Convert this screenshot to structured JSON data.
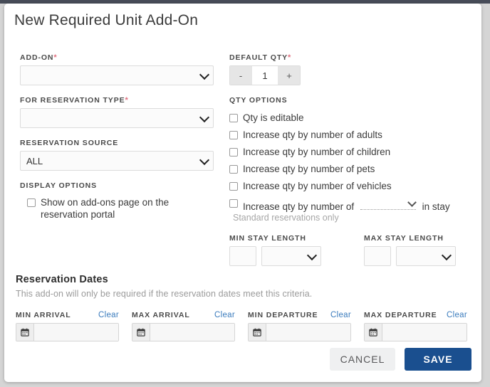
{
  "modal": {
    "title": "New Required Unit Add-On"
  },
  "left": {
    "addon": {
      "label": "ADD-ON",
      "required": "*",
      "value": ""
    },
    "reservation_type": {
      "label": "FOR RESERVATION TYPE",
      "required": "*",
      "value": ""
    },
    "reservation_source": {
      "label": "RESERVATION SOURCE",
      "value": "ALL"
    },
    "display_options": {
      "label": "DISPLAY OPTIONS",
      "checkbox": {
        "label": "Show on add-ons page on the reservation portal",
        "checked": false
      }
    }
  },
  "right": {
    "default_qty": {
      "label": "DEFAULT QTY",
      "required": "*",
      "value": "1",
      "decrement": "-",
      "increment": "+"
    },
    "qty_options": {
      "label": "QTY OPTIONS",
      "items": [
        {
          "label": "Qty is editable",
          "checked": false
        },
        {
          "label": "Increase qty by number of adults",
          "checked": false
        },
        {
          "label": "Increase qty by number of children",
          "checked": false
        },
        {
          "label": "Increase qty by number of pets",
          "checked": false
        },
        {
          "label": "Increase qty by number of vehicles",
          "checked": false
        }
      ],
      "custom_row": {
        "prefix": "Increase qty by number of",
        "select_value": "",
        "suffix": "in stay",
        "checked": false,
        "hint": "Standard reservations only"
      }
    },
    "min_stay": {
      "label": "MIN STAY LENGTH",
      "number": "",
      "unit": ""
    },
    "max_stay": {
      "label": "MAX STAY LENGTH",
      "number": "",
      "unit": ""
    }
  },
  "reservation_dates": {
    "title": "Reservation Dates",
    "description": "This add-on will only be required if the reservation dates meet this criteria.",
    "fields": [
      {
        "label": "MIN ARRIVAL",
        "clear": "Clear",
        "value": ""
      },
      {
        "label": "MAX ARRIVAL",
        "clear": "Clear",
        "value": ""
      },
      {
        "label": "MIN DEPARTURE",
        "clear": "Clear",
        "value": ""
      },
      {
        "label": "MAX DEPARTURE",
        "clear": "Clear",
        "value": ""
      }
    ]
  },
  "footer": {
    "cancel": "CANCEL",
    "save": "SAVE"
  },
  "colors": {
    "save_blue": "#1a4f8f",
    "link_blue": "#3b7cbd",
    "required_red": "#e0707f",
    "top_bar": "#474c58"
  }
}
